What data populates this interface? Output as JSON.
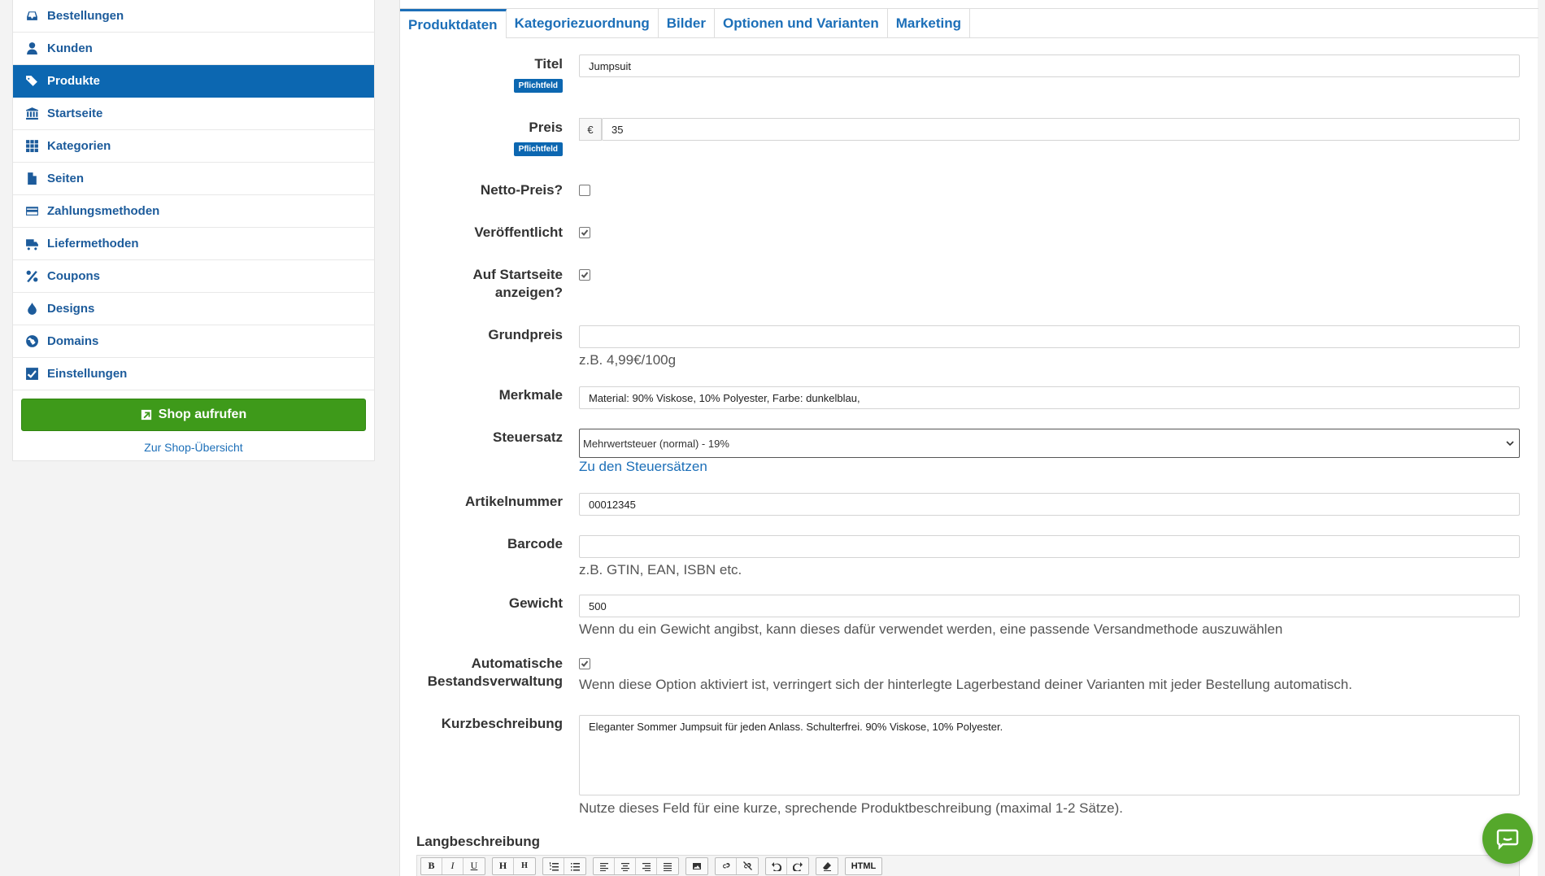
{
  "sidebar": {
    "items": [
      {
        "label": "Bestellungen",
        "icon": "inbox-icon"
      },
      {
        "label": "Kunden",
        "icon": "user-icon"
      },
      {
        "label": "Produkte",
        "icon": "tags-icon",
        "active": true
      },
      {
        "label": "Startseite",
        "icon": "bank-icon"
      },
      {
        "label": "Kategorien",
        "icon": "grid-icon"
      },
      {
        "label": "Seiten",
        "icon": "file-icon"
      },
      {
        "label": "Zahlungsmethoden",
        "icon": "credit-card-icon"
      },
      {
        "label": "Liefermethoden",
        "icon": "truck-icon"
      },
      {
        "label": "Coupons",
        "icon": "percent-icon"
      },
      {
        "label": "Designs",
        "icon": "droplet-icon"
      },
      {
        "label": "Domains",
        "icon": "globe-icon"
      },
      {
        "label": "Einstellungen",
        "icon": "check-square-icon"
      }
    ],
    "shop_button": "Shop aufrufen",
    "overview_link": "Zur Shop-Übersicht"
  },
  "tabs": [
    "Produktdaten",
    "Kategoriezuordnung",
    "Bilder",
    "Optionen und Varianten",
    "Marketing"
  ],
  "form": {
    "title_label": "Titel",
    "title_value": "Jumpsuit",
    "required_badge": "Pflichtfeld",
    "price_label": "Preis",
    "price_currency": "€",
    "price_value": "35",
    "net_price_label": "Netto-Preis?",
    "net_price_checked": false,
    "published_label": "Veröffentlicht",
    "published_checked": true,
    "homepage_label_1": "Auf Startseite",
    "homepage_label_2": "anzeigen?",
    "homepage_checked": true,
    "base_price_label": "Grundpreis",
    "base_price_value": "",
    "base_price_hint": "z.B. 4,99€/100g",
    "features_label": "Merkmale",
    "features_value": "Material: 90% Viskose, 10% Polyester, Farbe: dunkelblau,",
    "tax_label": "Steuersatz",
    "tax_value": "Mehrwertsteuer (normal) - 19%",
    "tax_link": "Zu den Steuersätzen",
    "sku_label": "Artikelnummer",
    "sku_value": "00012345",
    "barcode_label": "Barcode",
    "barcode_value": "",
    "barcode_hint": "z.B. GTIN, EAN, ISBN etc.",
    "weight_label": "Gewicht",
    "weight_value": "500",
    "weight_hint": "Wenn du ein Gewicht angibst, kann dieses dafür verwendet werden, eine passende Versandmethode auszuwählen",
    "stock_label_1": "Automatische",
    "stock_label_2": "Bestandsverwaltung",
    "stock_checked": true,
    "stock_hint": "Wenn diese Option aktiviert ist, verringert sich der hinterlegte Lagerbestand deiner Varianten mit jeder Bestellung automatisch.",
    "short_desc_label": "Kurzbeschreibung",
    "short_desc_value": "Eleganter Sommer Jumpsuit für jeden Anlass. Schulterfrei. 90% Viskose, 10% Polyester.",
    "short_desc_hint": "Nutze dieses Feld für eine kurze, sprechende Produktbeschreibung (maximal 1-2 Sätze).",
    "long_desc_label": "Langbeschreibung"
  },
  "toolbar": {
    "bold": "B",
    "italic": "I",
    "underline": "U",
    "h1": "H",
    "h2": "H",
    "html": "HTML"
  },
  "colors": {
    "accent": "#0c67b1",
    "shop_button": "#3e9a1a",
    "chat_button": "#55a82b"
  }
}
